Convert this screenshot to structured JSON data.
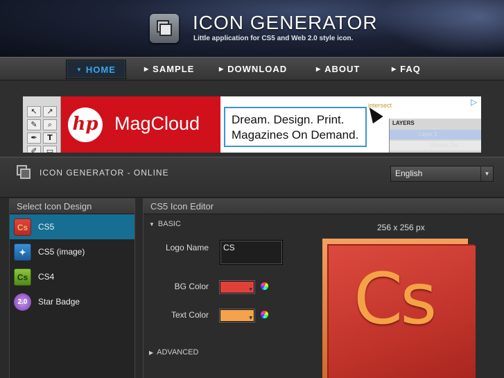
{
  "header": {
    "title": "ICON GENERATOR",
    "subtitle": "Little application for CS5 and Web 2.0 style icon."
  },
  "nav": {
    "items": [
      {
        "label": "HOME",
        "active": true
      },
      {
        "label": "SAMPLE",
        "active": false
      },
      {
        "label": "DOWNLOAD",
        "active": false
      },
      {
        "label": "ABOUT",
        "active": false
      },
      {
        "label": "FAQ",
        "active": false
      }
    ]
  },
  "ad": {
    "brand_logo": "hp",
    "brand_name": "MagCloud",
    "message_line1": "Dream. Design. Print.",
    "message_line2": "Magazines On Demand.",
    "intersect": "intersect",
    "layers_tab": "LAYERS",
    "layer1": "Layer 1",
    "layer2": "Dream, De"
  },
  "app": {
    "title": "ICON GENERATOR - ONLINE",
    "language": "English"
  },
  "list": {
    "heading": "Select Icon Design",
    "items": [
      {
        "label": "CS5",
        "icon_text": "Cs",
        "icon": "cs5-icon",
        "selected": true
      },
      {
        "label": "CS5 (image)",
        "icon_text": "✦",
        "icon": "puzzle-icon",
        "selected": false
      },
      {
        "label": "CS4",
        "icon_text": "Cs",
        "icon": "cs4-icon",
        "selected": false
      },
      {
        "label": "Star Badge",
        "icon_text": "2.0",
        "icon": "star-badge-icon",
        "selected": false
      }
    ]
  },
  "editor": {
    "heading": "CS5 Icon Editor",
    "basic_label": "BASIC",
    "advanced_label": "ADVANCED",
    "logo_name_label": "Logo Name",
    "logo_name_value": "CS",
    "bg_color_label": "BG Color",
    "bg_color": "#e0403a",
    "text_color_label": "Text Color",
    "text_color": "#f4a24c",
    "size_label": "256 x 256 px",
    "preview_text": "Cs"
  }
}
